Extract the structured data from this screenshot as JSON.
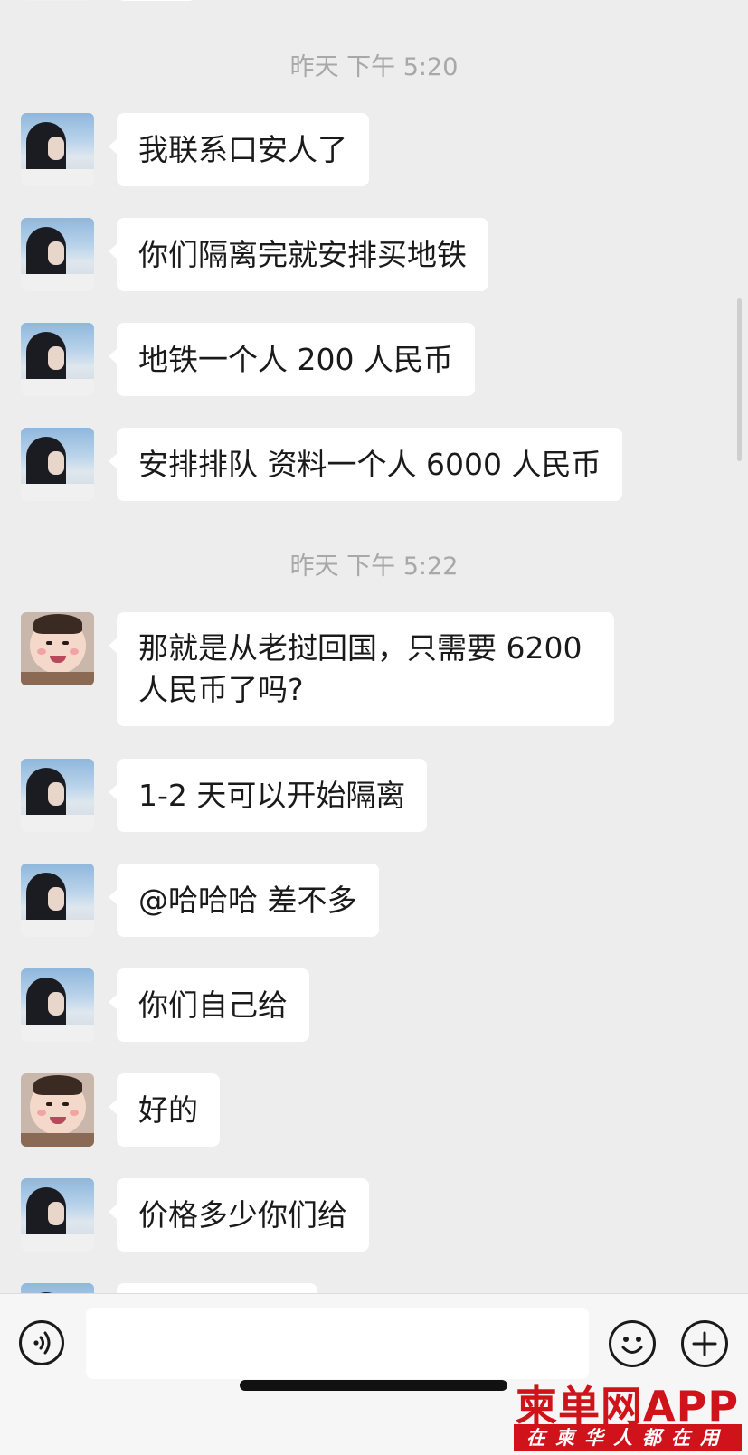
{
  "timestamps": [
    "昨天 下午 5:20",
    "昨天 下午 5:22"
  ],
  "messages": [
    {
      "sender": "girl",
      "text": "我联系口安人了"
    },
    {
      "sender": "girl",
      "text": "你们隔离完就安排买地铁"
    },
    {
      "sender": "girl",
      "text": "地铁一个人 200 人民币"
    },
    {
      "sender": "girl",
      "text": "安排排队 资料一个人 6000 人民币"
    },
    {
      "sender": "baby",
      "text_line1": "那就是从老挝回国，只需要 6200",
      "text_line2": "人民币了吗?"
    },
    {
      "sender": "girl",
      "text": "1-2 天可以开始隔离"
    },
    {
      "sender": "girl",
      "text": "@哈哈哈 差不多"
    },
    {
      "sender": "girl",
      "text": "你们自己给"
    },
    {
      "sender": "baby",
      "text": "好的"
    },
    {
      "sender": "girl",
      "text": "价格多少你们给"
    }
  ],
  "input": {
    "value": ""
  },
  "icons": {
    "voice": "voice-icon",
    "emoji": "emoji-icon",
    "plus": "plus-icon"
  },
  "watermark": {
    "main": "柬单网APP",
    "sub": "在柬华人都在用"
  },
  "colors": {
    "bubble": "#ffffff",
    "background": "#ededed",
    "timestamp": "#a8a8a8",
    "watermark": "#d0121b"
  }
}
